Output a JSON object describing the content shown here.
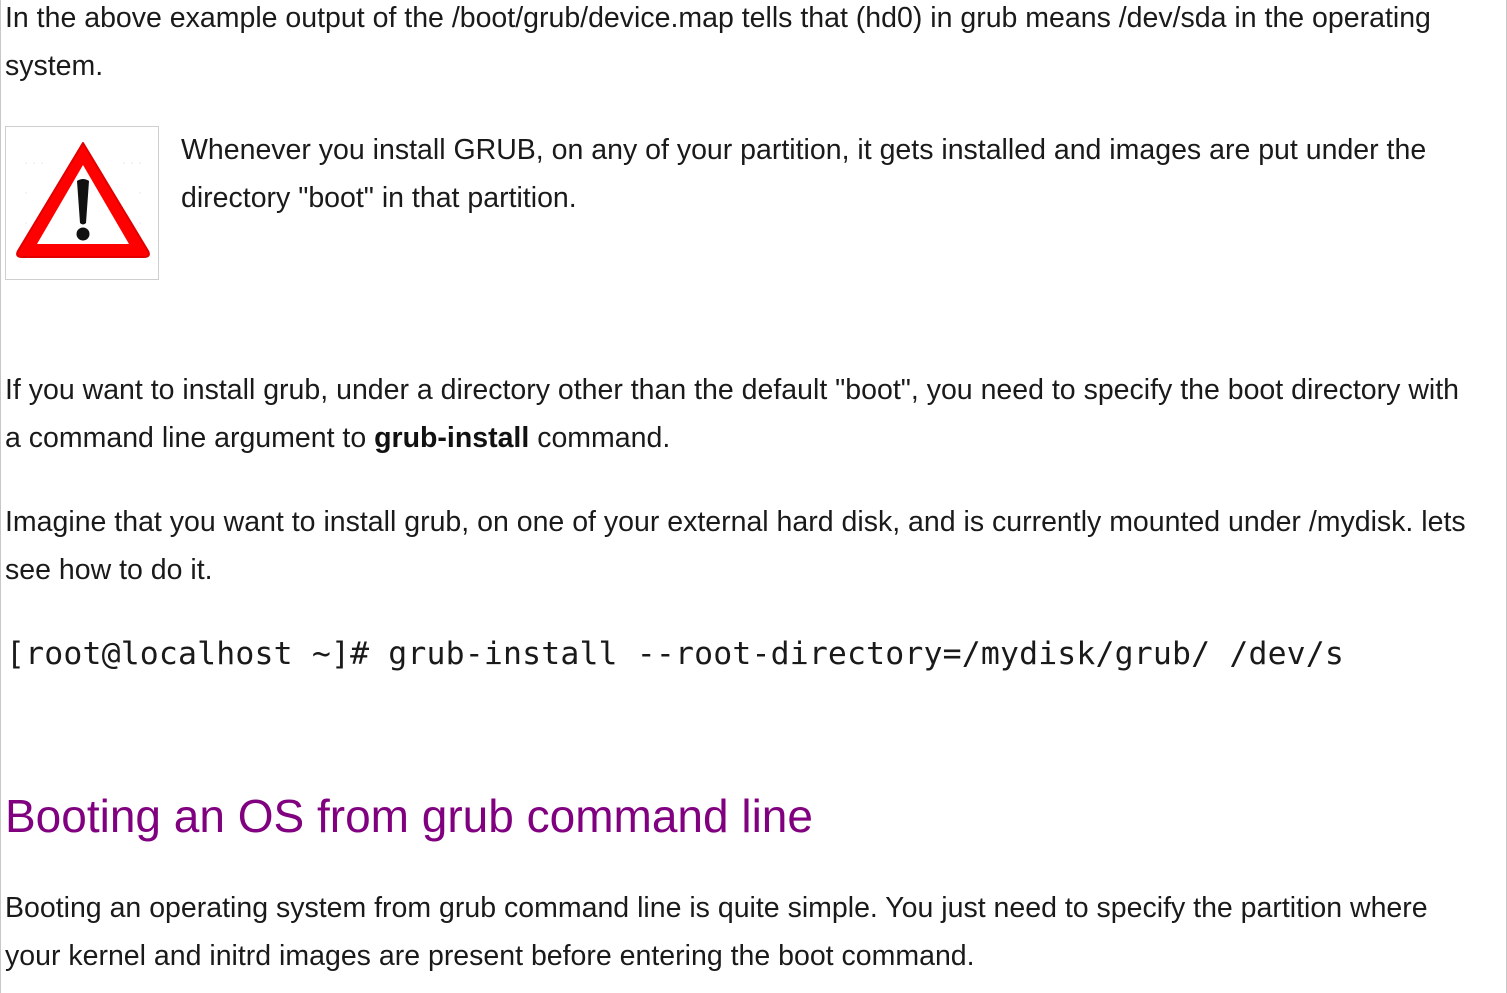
{
  "paragraphs": {
    "intro": "In the above example output of the /boot/grub/device.map tells that (hd0) in grub means /dev/sda in the operating system.",
    "note": "Whenever you install GRUB, on any of your partition, it gets installed and images are put under the directory \"boot\" in that partition.",
    "custom_dir_before": "If you want to install grub, under a directory other than the default \"boot\", you need to specify the boot directory with a command line argument to ",
    "custom_dir_bold": "grub-install",
    "custom_dir_after": " command.",
    "external_disk": "Imagine that you want to install grub, on one of your external hard disk, and is currently mounted under /mydisk. lets see how to do it.",
    "booting": "Booting an operating system from grub command line is quite simple. You just need to specify the partition where your kernel and initrd images are present before entering the boot command."
  },
  "code": {
    "command": "[root@localhost ~]# grub-install --root-directory=/mydisk/grub/ /dev/s"
  },
  "headings": {
    "booting_section": "Booting an OS from grub command line"
  },
  "icons": {
    "warning": "warning-triangle-icon"
  },
  "colors": {
    "heading": "#800080",
    "warning_red": "#ff0000",
    "text": "#1a1a1a"
  }
}
